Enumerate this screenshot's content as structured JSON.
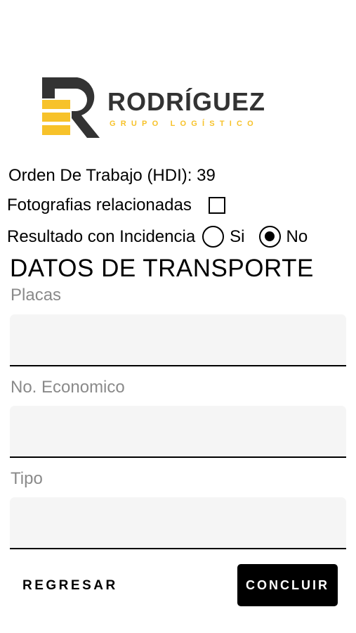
{
  "brand": {
    "name": "RODRÍGUEZ",
    "tagline": "GRUPO LOGÍSTICO",
    "colors": {
      "dark": "#333333",
      "accent": "#f7c22a"
    }
  },
  "order": {
    "text": "Orden De Trabajo (HDI): 39"
  },
  "photos": {
    "label": "Fotografias relacionadas",
    "checked": false
  },
  "incidence": {
    "label": "Resultado con Incidencia",
    "options": [
      {
        "label": "Si",
        "selected": false
      },
      {
        "label": "No",
        "selected": true
      }
    ]
  },
  "section": {
    "title": "DATOS DE TRANSPORTE"
  },
  "fields": [
    {
      "label": "Placas",
      "value": ""
    },
    {
      "label": "No. Economico",
      "value": ""
    },
    {
      "label": "Tipo",
      "value": ""
    }
  ],
  "actions": {
    "back": "REGRESAR",
    "submit": "CONCLUIR"
  }
}
